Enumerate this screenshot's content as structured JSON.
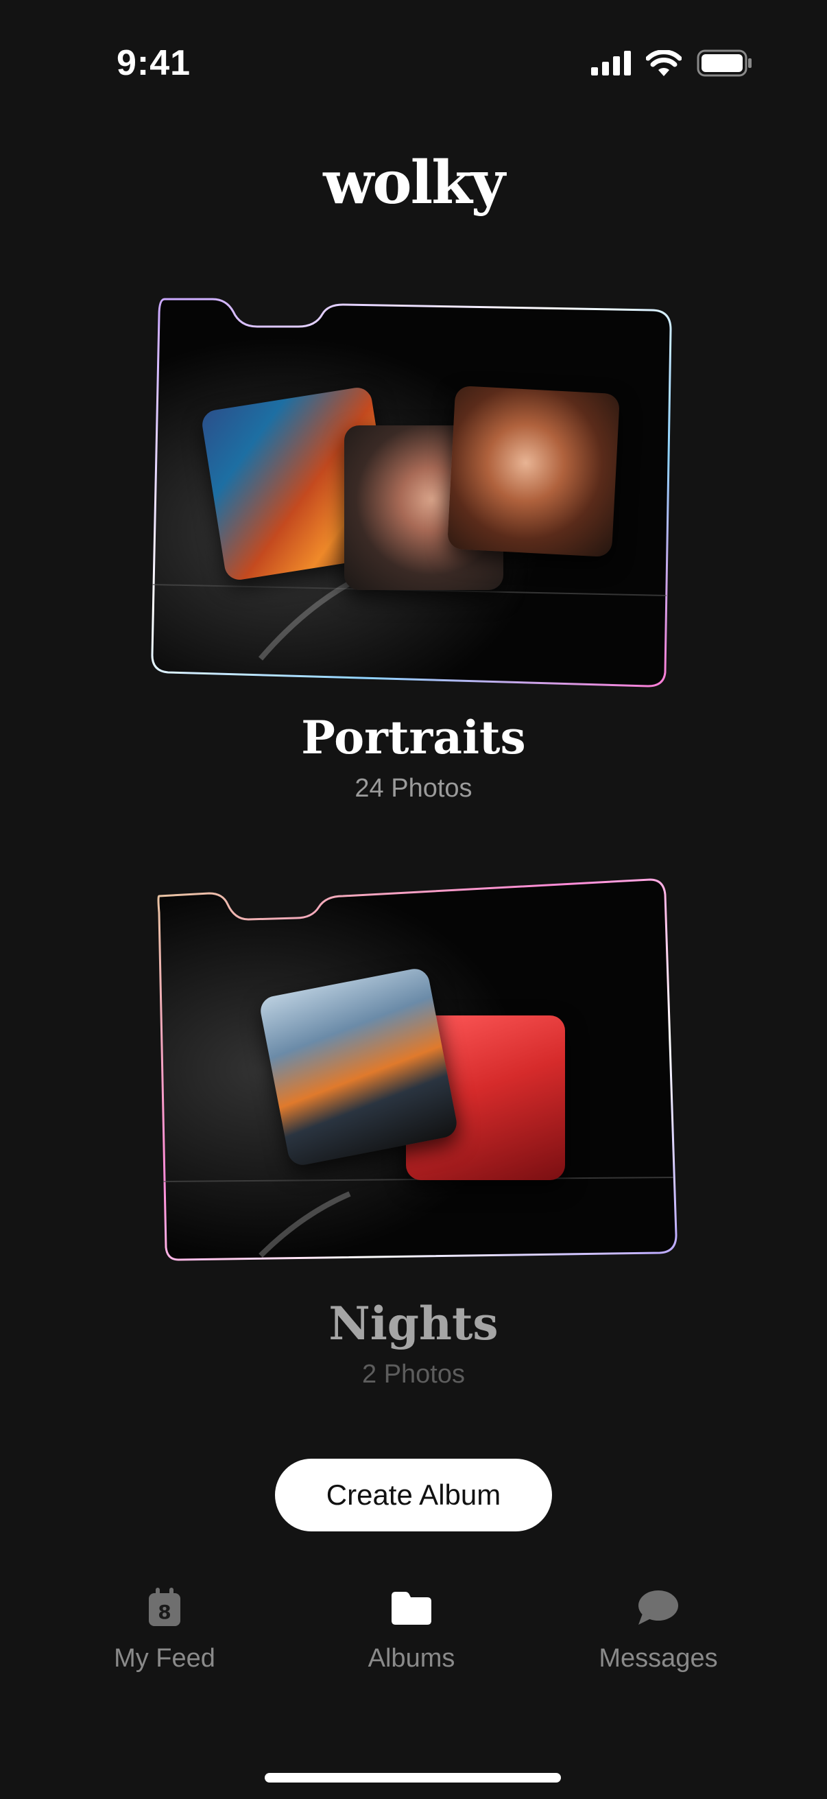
{
  "status": {
    "time": "9:41"
  },
  "app": {
    "logo": "wolky"
  },
  "albums": [
    {
      "title": "Portraits",
      "count": "24 Photos"
    },
    {
      "title": "Nights",
      "count": "2 Photos"
    }
  ],
  "actions": {
    "create_label": "Create Album"
  },
  "tabs": [
    {
      "label": "My Feed",
      "icon": "calendar-icon",
      "badge": "8",
      "active": false
    },
    {
      "label": "Albums",
      "icon": "folder-icon",
      "active": true
    },
    {
      "label": "Messages",
      "icon": "chat-bubble-icon",
      "active": false
    }
  ],
  "colors": {
    "background": "#131313",
    "accent": "#ffffff",
    "muted": "#8a8a8a"
  }
}
